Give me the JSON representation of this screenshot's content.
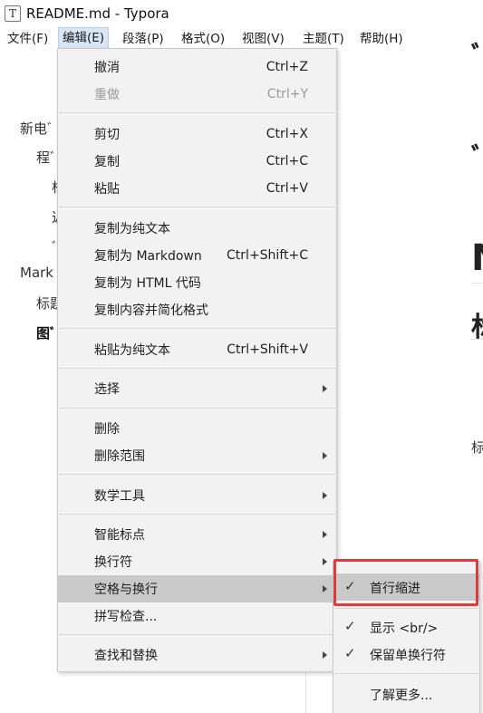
{
  "window": {
    "app_icon": "T",
    "title": "README.md - Typora"
  },
  "menubar": [
    {
      "label": "文件(F)"
    },
    {
      "label": "编辑(E)"
    },
    {
      "label": "段落(P)"
    },
    {
      "label": "格式(O)"
    },
    {
      "label": "视图(V)"
    },
    {
      "label": "主题(T)"
    },
    {
      "label": "帮助(H)"
    }
  ],
  "outline": [
    {
      "label": "新电ﾞ"
    },
    {
      "label": "程ﾞ"
    },
    {
      "label": "标"
    },
    {
      "label": "近"
    },
    {
      "label": "ﾞ"
    },
    {
      "label": "Mark"
    },
    {
      "label": "标题"
    },
    {
      "label": "图ﾞ"
    }
  ],
  "doc_fragments": {
    "glyph_1": "ﾞ",
    "glyph_2": "ﾞ",
    "glyph_3": "N",
    "glyph_4": "标",
    "small_text": "标"
  },
  "edit_menu": {
    "undo": {
      "label": "撤消",
      "shortcut": "Ctrl+Z"
    },
    "redo": {
      "label": "重做",
      "shortcut": "Ctrl+Y"
    },
    "cut": {
      "label": "剪切",
      "shortcut": "Ctrl+X"
    },
    "copy": {
      "label": "复制",
      "shortcut": "Ctrl+C"
    },
    "paste": {
      "label": "粘贴",
      "shortcut": "Ctrl+V"
    },
    "copy_plain": {
      "label": "复制为纯文本"
    },
    "copy_markdown": {
      "label": "复制为 Markdown",
      "shortcut": "Ctrl+Shift+C"
    },
    "copy_html": {
      "label": "复制为 HTML 代码"
    },
    "copy_simplified": {
      "label": "复制内容并简化格式"
    },
    "paste_plain": {
      "label": "粘贴为纯文本",
      "shortcut": "Ctrl+Shift+V"
    },
    "select": {
      "label": "选择"
    },
    "delete": {
      "label": "删除"
    },
    "delete_range": {
      "label": "删除范围"
    },
    "math_tools": {
      "label": "数学工具"
    },
    "smart_punctuation": {
      "label": "智能标点"
    },
    "line_break": {
      "label": "换行符"
    },
    "whitespace": {
      "label": "空格与换行"
    },
    "spellcheck": {
      "label": "拼写检查..."
    },
    "find_replace": {
      "label": "查找和替换"
    }
  },
  "whitespace_submenu": {
    "first_line_indent": {
      "label": "首行缩进",
      "checked": true
    },
    "show_br": {
      "label": "显示 <br/>",
      "checked": true
    },
    "keep_single_linebreak": {
      "label": "保留单换行符",
      "checked": true
    },
    "learn_more": {
      "label": "了解更多..."
    }
  },
  "colors": {
    "menu_bg": "#f2f2f2",
    "highlight": "#c9c9c9",
    "annotation_red": "#e0393e"
  }
}
